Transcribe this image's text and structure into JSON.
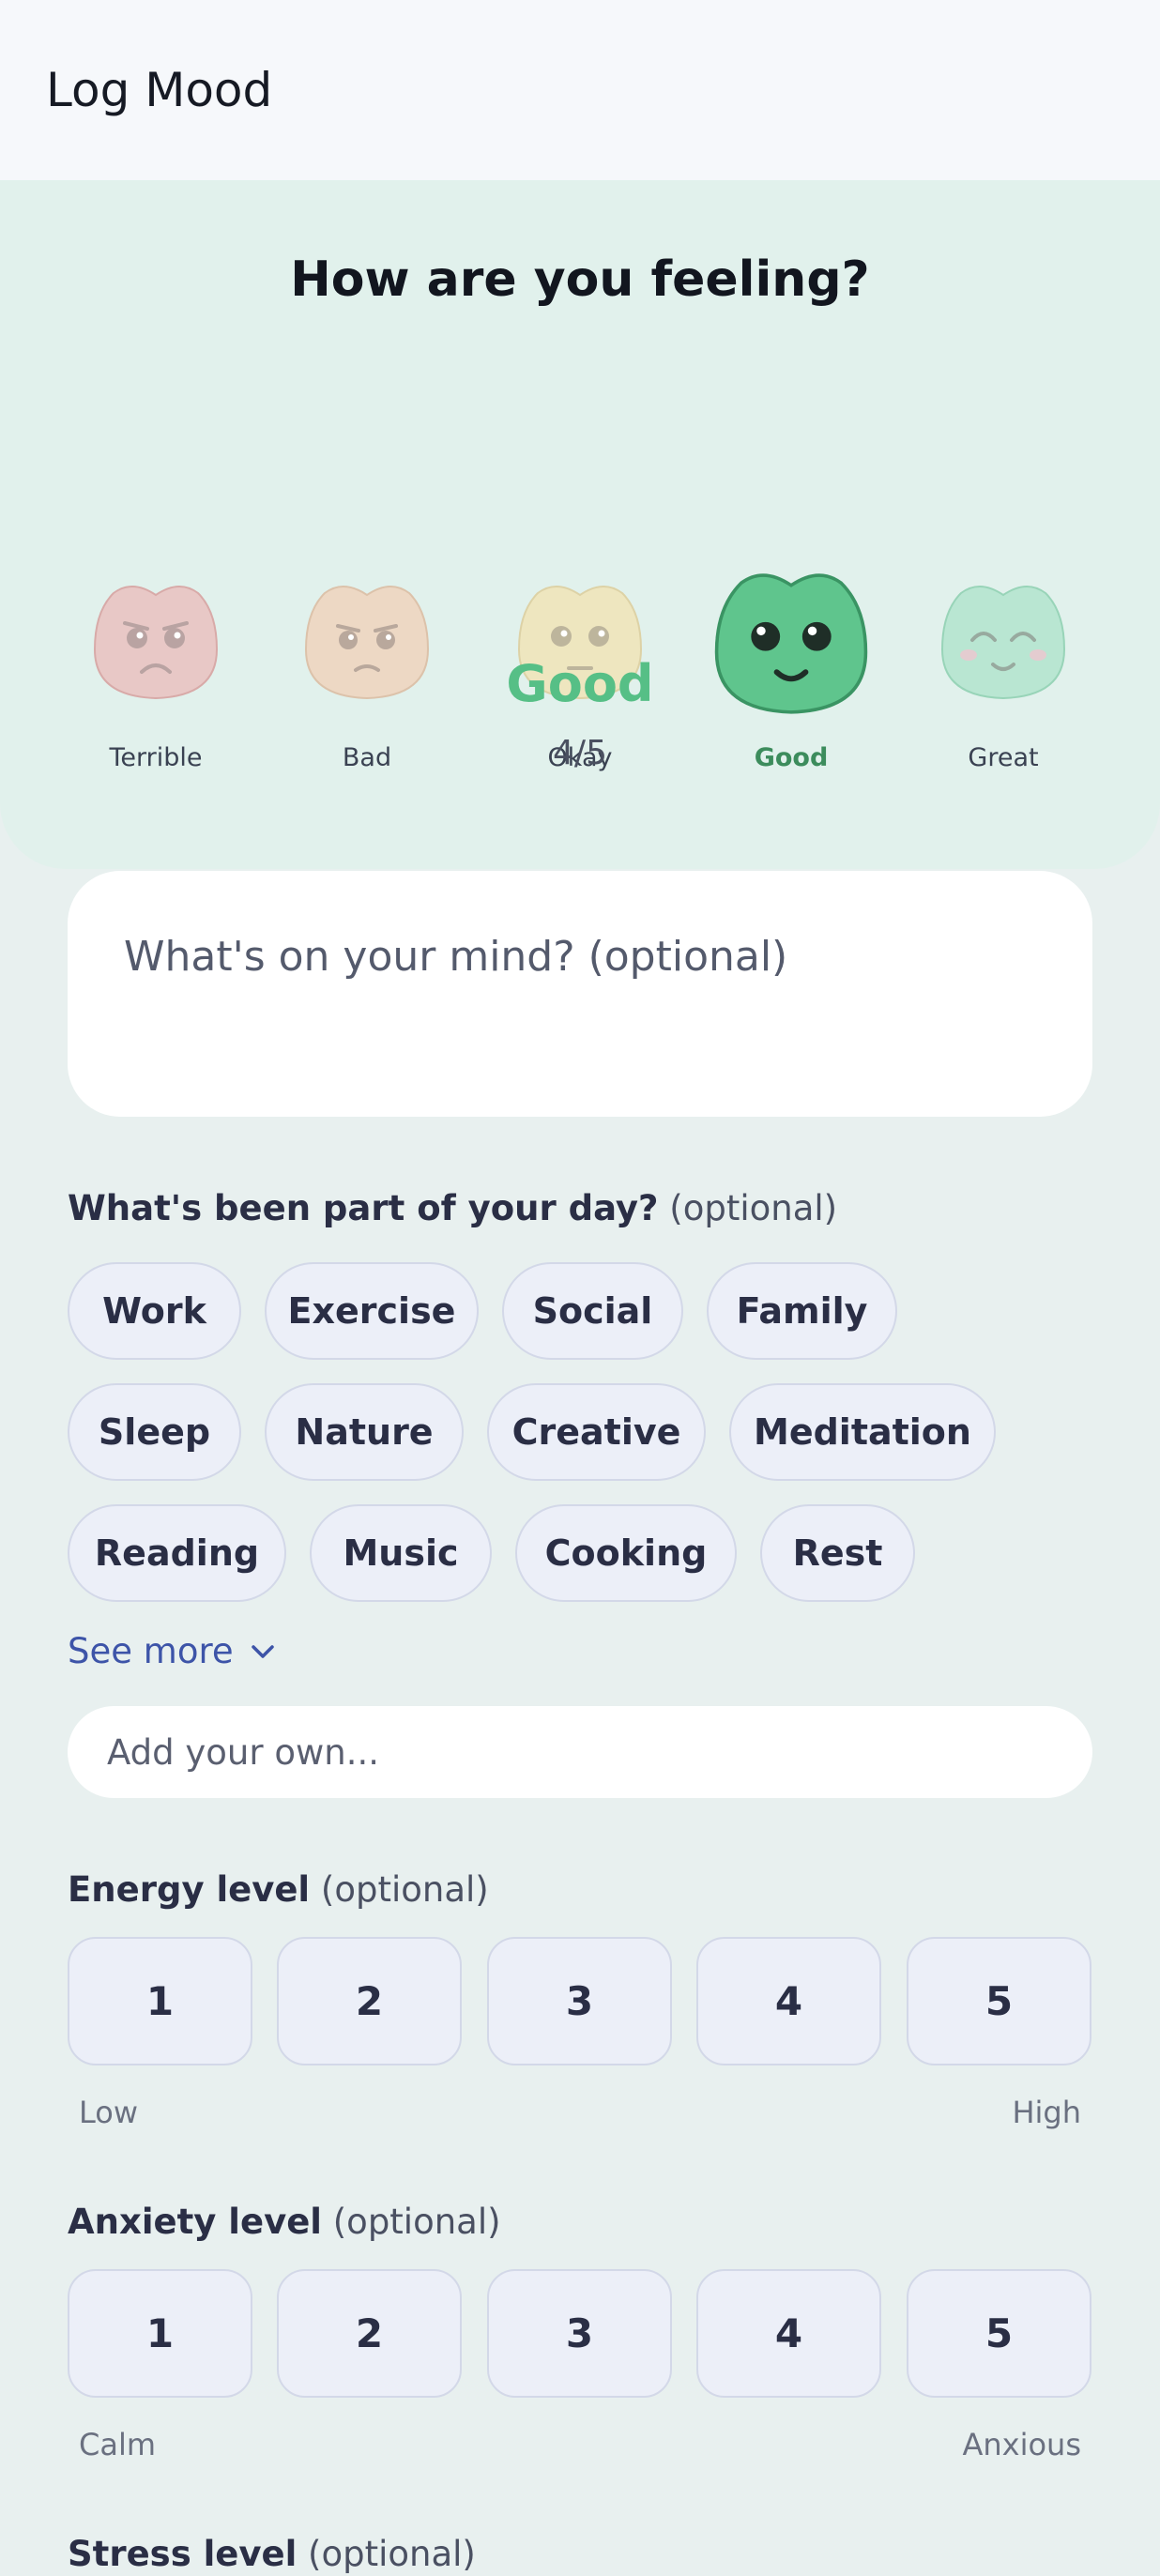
{
  "header": {
    "title": "Log Mood"
  },
  "mood": {
    "question": "How are you feeling?",
    "options": [
      {
        "label": "Terrible",
        "icon": "terrible-face-icon",
        "color": "#e8c8c6"
      },
      {
        "label": "Bad",
        "icon": "bad-face-icon",
        "color": "#edd8c4"
      },
      {
        "label": "Okay",
        "icon": "okay-face-icon",
        "color": "#eee6bf"
      },
      {
        "label": "Good",
        "icon": "good-face-icon",
        "color": "#5fc58d"
      },
      {
        "label": "Great",
        "icon": "great-face-icon",
        "color": "#b9e6d2"
      }
    ],
    "selected_name": "Good",
    "selected_score": "4/5"
  },
  "note": {
    "placeholder": "What's on your mind? (optional)"
  },
  "activities": {
    "title": "What's been part of your day?",
    "optional": " (optional)",
    "chips": [
      "Work",
      "Exercise",
      "Social",
      "Family",
      "Sleep",
      "Nature",
      "Creative",
      "Meditation",
      "Reading",
      "Music",
      "Cooking",
      "Rest"
    ],
    "see_more": "See more",
    "add_placeholder": "Add your own..."
  },
  "energy": {
    "title": "Energy level",
    "optional": " (optional)",
    "levels": [
      "1",
      "2",
      "3",
      "4",
      "5"
    ],
    "low": "Low",
    "high": "High"
  },
  "anxiety": {
    "title": "Anxiety level",
    "optional": " (optional)",
    "levels": [
      "1",
      "2",
      "3",
      "4",
      "5"
    ],
    "low": "Calm",
    "high": "Anxious"
  },
  "stress": {
    "title": "Stress level",
    "optional": " (optional)"
  },
  "colors": {
    "accent_green": "#56bf86",
    "link_blue": "#3d54a8",
    "chip_bg": "#eceff8"
  }
}
